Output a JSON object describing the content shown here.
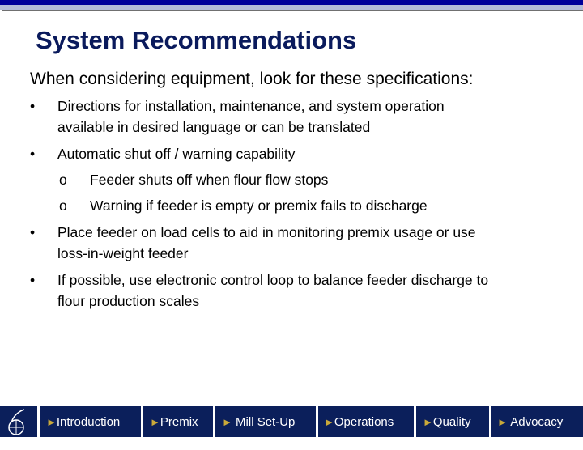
{
  "title": "System Recommendations",
  "intro": "When considering equipment, look for these specifications:",
  "bullets": [
    {
      "lines": [
        "Directions for installation, maintenance, and system operation",
        "available in desired language or can be translated"
      ]
    },
    {
      "lines": [
        "Automatic shut off / warning capability"
      ]
    },
    {
      "lines": [
        "Place feeder on load cells to aid in monitoring premix usage or use",
        "loss-in-weight feeder"
      ]
    },
    {
      "lines": [
        "If possible, use electronic control loop to balance feeder discharge to",
        "flour production scales"
      ]
    }
  ],
  "sub_bullets": [
    "Feeder shuts off when flour flow stops",
    "Warning if feeder is empty or premix fails to discharge"
  ],
  "bullet_marker": "•",
  "sub_marker": "o",
  "nav": {
    "arrow": "►",
    "items": [
      "Introduction",
      "Premix",
      "Mill Set-Up",
      "Operations",
      "Quality",
      "Advocacy"
    ]
  },
  "colors": {
    "nav_bg": "#0b1f5b",
    "arrow": "#c9a93a",
    "title": "#0a1a5c"
  }
}
